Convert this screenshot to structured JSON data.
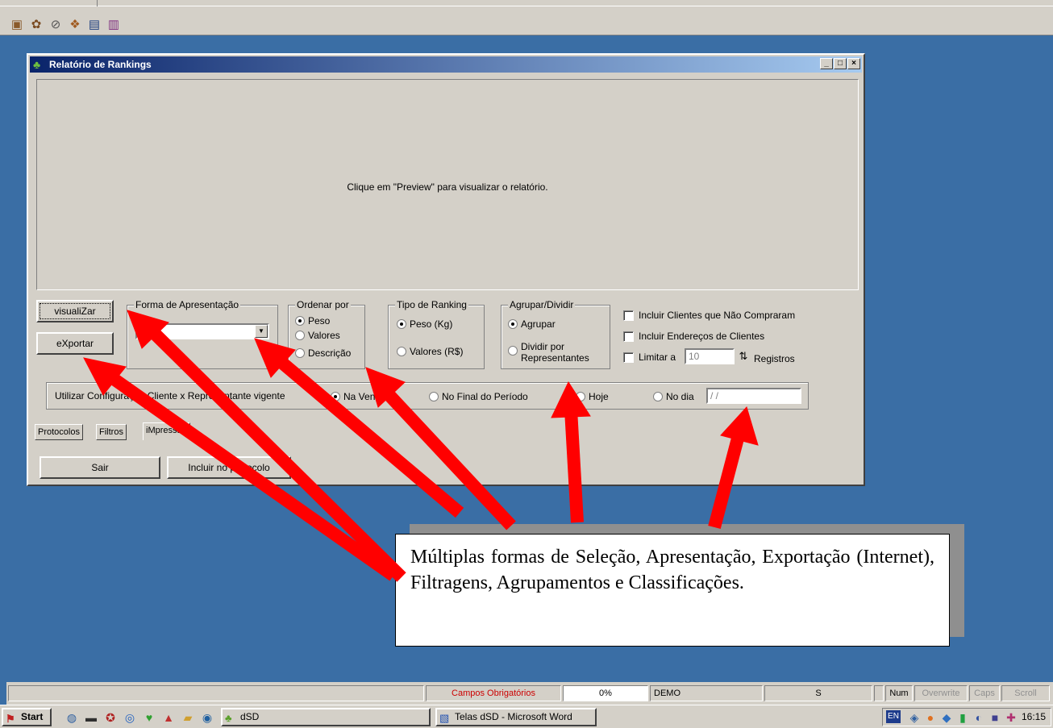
{
  "toolbar": {
    "icons": [
      "gift-icon",
      "gear-icon",
      "link-icon",
      "package-icon",
      "report-icon",
      "document-icon"
    ]
  },
  "window": {
    "title": "Relatório de Rankings",
    "controls": [
      "_",
      "□",
      "×"
    ],
    "preview_message": "Clique em \"Preview\" para visualizar o relatório.",
    "buttons": {
      "visualizar": "visualiZar",
      "exportar": "eXportar",
      "sair": "Sair",
      "incluir": "Incluir no protocolo"
    },
    "forma_apresentacao": {
      "label": "Forma de Apresentação",
      "value": "ntes"
    },
    "ordenar_por": {
      "label": "Ordenar por",
      "options": [
        "Peso",
        "Valores",
        "Descrição"
      ],
      "selected": "Peso"
    },
    "tipo_ranking": {
      "label": "Tipo de Ranking",
      "options": [
        "Peso (Kg)",
        "Valores (R$)"
      ],
      "selected": "Peso (Kg)"
    },
    "agrupar_dividir": {
      "label": "Agrupar/Dividir",
      "options": [
        "Agrupar",
        "Dividir por Representantes"
      ],
      "selected": "Agrupar"
    },
    "checks": {
      "clientes_nao_compraram": "Incluir Clientes que Não Compraram",
      "enderecos": "Incluir Endereços de Clientes",
      "limitar_prefix": "Limitar a",
      "limitar_value": "10",
      "limitar_suffix": "Registros"
    },
    "config": {
      "label": "Utilizar Configuração Cliente x Representante vigente",
      "options": [
        "Na Venda",
        "No Final do Período",
        "Hoje",
        "No dia"
      ],
      "selected": "Na Venda",
      "date_placeholder": "/ /"
    },
    "tabs": [
      "Protocolos",
      "Filtros",
      "iMpressão"
    ]
  },
  "statusbar": {
    "campos": "Campos Obrigatórios",
    "progress": "0%",
    "mode": "DEMO",
    "s": "S",
    "num": "Num",
    "overwrite": "Overwrite",
    "caps": "Caps",
    "scroll": "Scroll"
  },
  "taskbar": {
    "start": "Start",
    "tasks": [
      "dSD",
      "Telas dSD - Microsoft Word"
    ],
    "lang": "EN",
    "clock": "16:15"
  },
  "callout": {
    "text": "Múltiplas formas de Seleção, Apresentação, Exportação (Internet), Filtragens, Agrupamentos e Classificações."
  },
  "colors": {
    "desktop": "#3a6ea5",
    "face": "#d4d0c8",
    "title_start": "#0a246a",
    "title_end": "#a6caf0",
    "arrow": "#ff0000",
    "status_red": "#cc0000"
  }
}
